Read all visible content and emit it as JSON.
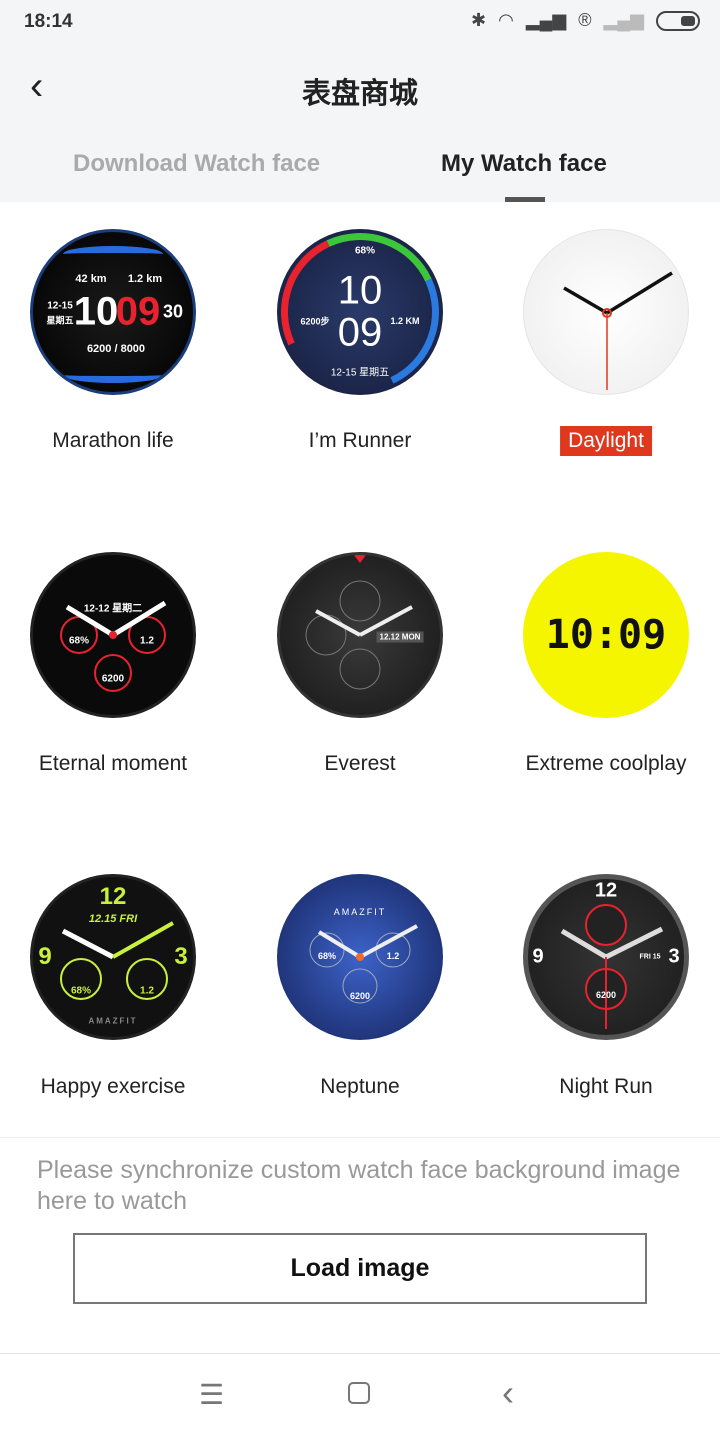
{
  "status_bar": {
    "time": "18:14",
    "icons": [
      "bluetooth-icon",
      "wifi-icon",
      "signal-icon",
      "registered-icon",
      "signal-weak-icon",
      "battery-icon"
    ]
  },
  "header": {
    "title": "表盘商城",
    "back_icon": "chevron-left-icon"
  },
  "tabs": [
    {
      "label": "Download Watch face",
      "active": false
    },
    {
      "label": "My Watch face",
      "active": true
    }
  ],
  "watch_faces": [
    {
      "name": "Marathon life",
      "selected": false,
      "face_text": {
        "dist": "42 km",
        "run": "1.2 km",
        "date": "12-15",
        "day": "星期五",
        "hour": "10",
        "min": "09",
        "sec": "30",
        "steps": "6200 / 8000"
      }
    },
    {
      "name": "I’m Runner",
      "selected": false,
      "face_text": {
        "battery": "68%",
        "hour": "10",
        "min": "09",
        "steps": "6200步",
        "dist": "1.2 KM",
        "date": "12-15 星期五"
      }
    },
    {
      "name": "Daylight",
      "selected": true,
      "face_text": {}
    },
    {
      "name": "Eternal moment",
      "selected": false,
      "face_text": {
        "date": "12-12 星期二",
        "battery": "68%",
        "dist": "1.2",
        "steps": "6200"
      }
    },
    {
      "name": "Everest",
      "selected": false,
      "face_text": {
        "date": "12.12",
        "day": "MON"
      }
    },
    {
      "name": "Extreme coolplay",
      "selected": false,
      "face_text": {
        "time": "10:09"
      }
    },
    {
      "name": "Happy exercise",
      "selected": false,
      "face_text": {
        "hour": "12",
        "date": "12.15 FRI",
        "left": "9",
        "right": "3",
        "battery": "68%",
        "dist": "1.2",
        "brand": "AMAZFIT"
      }
    },
    {
      "name": "Neptune",
      "selected": false,
      "face_text": {
        "brand": "AMAZFIT",
        "battery": "68%",
        "dist": "1.2",
        "steps": "6200"
      }
    },
    {
      "name": "Night Run",
      "selected": false,
      "face_text": {
        "hour": "12",
        "left": "9",
        "right": "3",
        "day": "FRI",
        "date": "15",
        "steps": "6200"
      }
    }
  ],
  "footer": {
    "hint": "Please synchronize custom watch face background image here to watch",
    "load_button": "Load image"
  },
  "nav_bar": {
    "menu_icon": "☰",
    "home_icon": "▢",
    "back_icon": "‹"
  },
  "colors": {
    "selected_label_bg": "#e0371f",
    "tab_active": "#222222",
    "tab_inactive": "#aaaaaa",
    "extreme_yellow": "#f5f500"
  }
}
